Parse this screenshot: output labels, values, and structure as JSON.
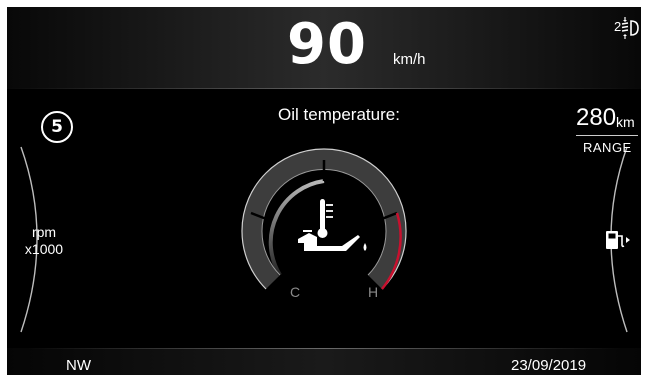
{
  "speed": {
    "value": "90",
    "unit": "km/h"
  },
  "headlight": {
    "level": "2",
    "icon": "headlight-leveling-icon"
  },
  "gear": {
    "value": "5"
  },
  "tachometer": {
    "label_line1": "rpm",
    "label_line2": "x1000"
  },
  "range": {
    "value": "280",
    "unit": "km",
    "label": "RANGE"
  },
  "fuel": {
    "icon": "fuel-pump-icon"
  },
  "oil_gauge": {
    "title": "Oil temperature:",
    "cold_label": "C",
    "hot_label": "H",
    "icon": "oil-can-thermometer-icon",
    "warning_color": "#c8102e"
  },
  "footer": {
    "heading": "NW",
    "date": "23/09/2019"
  }
}
